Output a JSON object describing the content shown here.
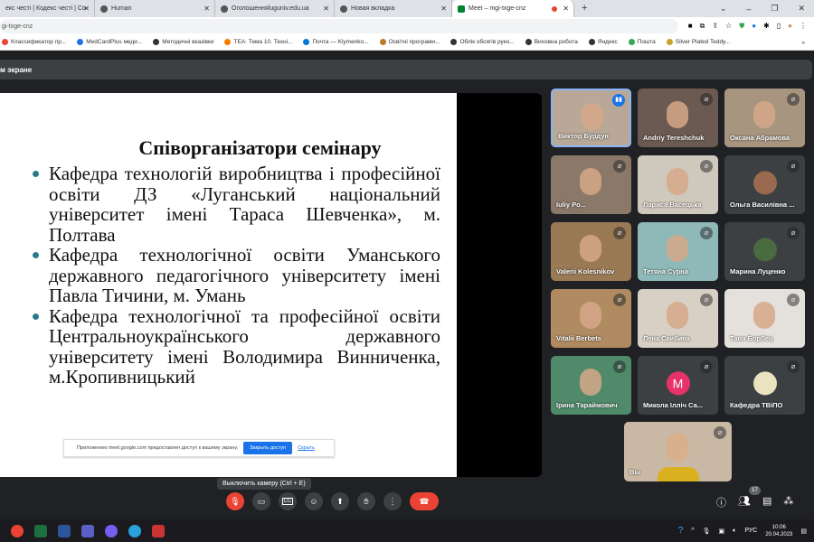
{
  "browser": {
    "tabs": [
      {
        "label": "екс честі | Кодекс честі | Со",
        "active": false
      },
      {
        "label": "Human",
        "active": false
      },
      {
        "label": "Оголошенняluguniv.edu.ua",
        "active": false
      },
      {
        "label": "Новая вкладка",
        "active": false
      },
      {
        "label": "Meet – mgi-txge-cnz",
        "active": true
      }
    ],
    "new_tab": "+",
    "url": "gi-txge-cnz",
    "bookmarks": [
      "Классификатор пр...",
      "MedCardPlus меди...",
      "Методичні вказівки",
      "TEA: Тема 10. Техні...",
      "Почта — Klymenko...",
      "Освітні програми...",
      "Облік обсягів руко...",
      "Виховна робота",
      "Яндекс",
      "Пошта",
      "Silver Plated Teddy..."
    ],
    "bookmark_colors": [
      "#e8453c",
      "#1a73e8",
      "#333",
      "#f57c00",
      "#0078d4",
      "#c0762b",
      "#333",
      "#333",
      "#333",
      "#34a853",
      "#c9a227"
    ]
  },
  "meet": {
    "share_banner": "м экране",
    "slide": {
      "title": "Співорганізатори семінару",
      "bullets": [
        "Кафедра технологій виробництва і професійної освіти ДЗ «Луганський національний університет імені Тараса Шевченка», м. Полтава",
        "Кафедра технологічної освіти Уманського державного педагогічного університету імені Павла Тичини, м. Умань",
        "Кафедра технологічної та професійної освіти Центральноукраїнського державного університету імені Володимира Винниченка, м.Кропивницький"
      ]
    },
    "share_notice": {
      "text": "Приложению meet.google.com предоставлен доступ к вашему экрану.",
      "stop": "Закрыть доступ",
      "hide": "Скрыть"
    },
    "participants": [
      {
        "name": "Виктор Бурдун",
        "bg": "#b9a898",
        "speaking": true
      },
      {
        "name": "Andriy Tereshchuk",
        "bg": "#6b5a52"
      },
      {
        "name": "Оксана Абрамова",
        "bg": "#a89580"
      },
      {
        "name": "Iuliy Po...",
        "bg": "#8a7868"
      },
      {
        "name": "Лариса Васецька",
        "bg": "#cfc8bc"
      },
      {
        "name": "Ольга Василівна ...",
        "bg": "#3c4043",
        "avatar": "#9a6a50"
      },
      {
        "name": "Valerii Kolesnikov",
        "bg": "#9a7a55"
      },
      {
        "name": "Тетяна Сурна",
        "bg": "#8fb8b8"
      },
      {
        "name": "Марина Луценко",
        "bg": "#3c4043",
        "avatar": "#4a6a40"
      },
      {
        "name": "Vitalii Berbets",
        "bg": "#b08a60"
      },
      {
        "name": "Лена Скибина",
        "bg": "#d8d0c4"
      },
      {
        "name": "Таня Борбец",
        "bg": "#e4e0dc"
      },
      {
        "name": "Ірина Тараймович",
        "bg": "#4f8a6a"
      },
      {
        "name": "Микола Ілліч Са...",
        "bg": "#3c4043",
        "avatar": "#e8336a",
        "initial": "M"
      },
      {
        "name": "Кафедра ТВіПО",
        "bg": "#3c4043",
        "avatar": "#e9e3c0"
      }
    ],
    "self": {
      "name": "Вы",
      "bg": "#c8b8a4"
    },
    "tooltip": "Выключить камеру (Ctrl + E)",
    "participant_count": "17",
    "controls": [
      "mic-off",
      "camera",
      "captions",
      "emoji",
      "present",
      "raise-hand",
      "more",
      "end-call"
    ]
  },
  "taskbar": {
    "lang": "РУС",
    "time": "10:06",
    "date": "20.04.2023"
  }
}
